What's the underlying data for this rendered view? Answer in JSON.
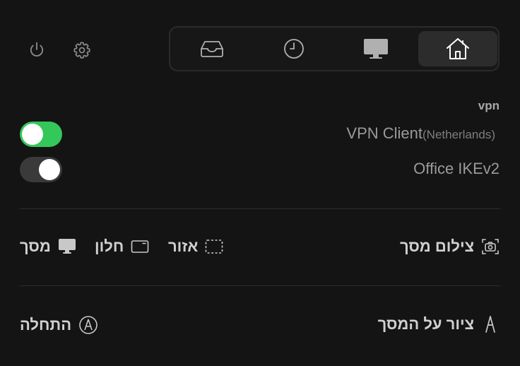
{
  "header": {
    "power_icon": "power-icon",
    "settings_icon": "gear-icon",
    "tabs": [
      {
        "icon": "inbox-tray-icon",
        "active": false
      },
      {
        "icon": "clock-icon",
        "active": false
      },
      {
        "icon": "monitor-icon",
        "active": false
      },
      {
        "icon": "home-icon",
        "active": true
      }
    ]
  },
  "vpn": {
    "title": "vpn",
    "items": [
      {
        "name": "VPN Client",
        "detail": "(Netherlands)",
        "enabled": true
      },
      {
        "name": "Office IKEv2",
        "detail": "",
        "enabled": false
      }
    ]
  },
  "screenshot": {
    "label": "צילום מסך",
    "icon": "camera-icon",
    "options": [
      {
        "label": "מסך",
        "icon": "monitor-icon"
      },
      {
        "label": "חלון",
        "icon": "window-icon"
      },
      {
        "label": "אזור",
        "icon": "dashed-area-icon"
      }
    ]
  },
  "draw": {
    "label": "ציור על המסך",
    "icon": "pen-nib-icon",
    "start_label": "התחלה",
    "start_icon": "compass-circle-icon"
  },
  "colors": {
    "toggle_on": "#34c759",
    "toggle_off": "#3a3a3a",
    "background": "#141414"
  }
}
